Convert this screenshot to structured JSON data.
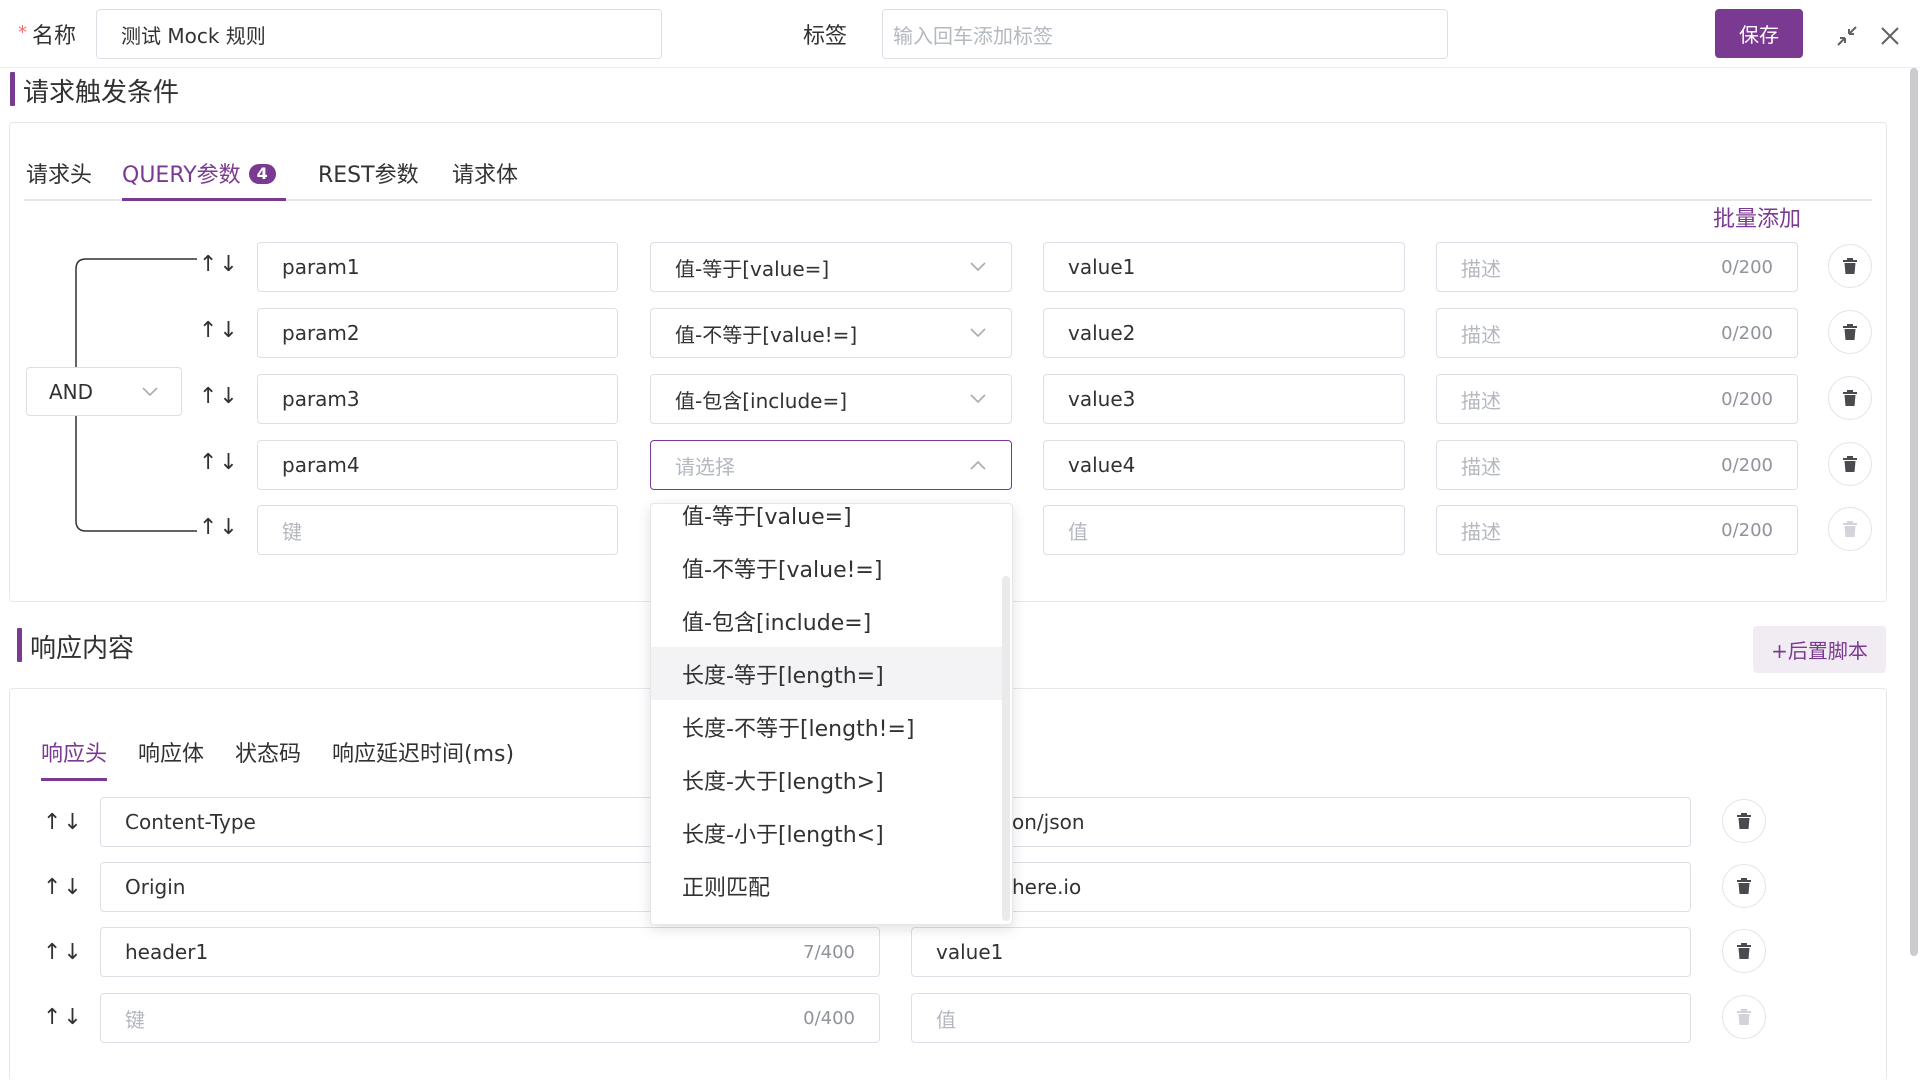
{
  "colors": {
    "accent": "#7b3a91",
    "border": "#dcdfe6",
    "placeholder": "#b4b8c0"
  },
  "header": {
    "required_mark": "*",
    "name_label": "名称",
    "name_value": "测试 Mock 规则",
    "tags_label": "标签",
    "tags_placeholder": "输入回车添加标签",
    "save_label": "保存",
    "icons": [
      "collapse-icon",
      "close-icon"
    ]
  },
  "request": {
    "section_title": "请求触发条件",
    "tabs": [
      {
        "label": "请求头"
      },
      {
        "label": "QUERY参数",
        "badge": "4"
      },
      {
        "label": "REST参数"
      },
      {
        "label": "请求体"
      }
    ],
    "bulk_add_label": "批量添加",
    "logic_operator": "AND",
    "rows": [
      {
        "arrows": "↑↓",
        "key": "param1",
        "operator": "值-等于[value=]",
        "value": "value1",
        "desc_placeholder": "描述",
        "desc_count": "0/200"
      },
      {
        "arrows": "↑↓",
        "key": "param2",
        "operator": "值-不等于[value!=]",
        "value": "value2",
        "desc_placeholder": "描述",
        "desc_count": "0/200"
      },
      {
        "arrows": "↑↓",
        "key": "param3",
        "operator": "值-包含[include=]",
        "value": "value3",
        "desc_placeholder": "描述",
        "desc_count": "0/200"
      },
      {
        "arrows": "↑↓",
        "key": "param4",
        "operator_placeholder": "请选择",
        "value": "value4",
        "desc_placeholder": "描述",
        "desc_count": "0/200"
      }
    ],
    "empty_row": {
      "arrows": "↑↓",
      "key_placeholder": "键",
      "value_placeholder": "值",
      "desc_placeholder": "描述",
      "desc_count": "0/200"
    }
  },
  "dropdown": {
    "options": [
      "值-等于[value=]",
      "值-不等于[value!=]",
      "值-包含[include=]",
      "长度-等于[length=]",
      "长度-不等于[length!=]",
      "长度-大于[length>]",
      "长度-小于[length<]",
      "正则匹配"
    ],
    "hovered_index": 3
  },
  "response": {
    "section_title": "响应内容",
    "post_script_label": "+后置脚本",
    "tabs": [
      {
        "label": "响应头"
      },
      {
        "label": "响应体"
      },
      {
        "label": "状态码"
      },
      {
        "label": "响应延迟时间(ms)"
      }
    ],
    "rows": [
      {
        "arrows": "↑↓",
        "key": "Content-Type",
        "value_visible": "on/json"
      },
      {
        "arrows": "↑↓",
        "key": "Origin",
        "value_visible": "here.io"
      },
      {
        "arrows": "↑↓",
        "key": "header1",
        "key_count": "7/400",
        "value": "value1"
      }
    ],
    "empty_row": {
      "arrows": "↑↓",
      "key_placeholder": "键",
      "key_count": "0/400",
      "value_placeholder": "值"
    }
  }
}
